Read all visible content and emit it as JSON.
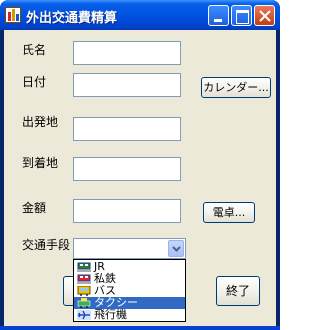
{
  "window": {
    "title": "外出交通費精算",
    "minimize_label": "minimize",
    "maximize_label": "maximize",
    "close_label": "close"
  },
  "form": {
    "name_label": "氏名",
    "date_label": "日付",
    "departure_label": "出発地",
    "arrival_label": "到着地",
    "amount_label": "金額",
    "transport_label": "交通手段",
    "name_value": "",
    "date_value": "",
    "departure_value": "",
    "arrival_value": "",
    "amount_value": "",
    "transport_value": ""
  },
  "buttons": {
    "calendar": "カレンダー...",
    "calculator": "電卓...",
    "exit": "終了"
  },
  "dropdown": {
    "options": [
      {
        "label": "JR",
        "icon": "train-icon",
        "selected": false
      },
      {
        "label": "私鉄",
        "icon": "train-icon",
        "selected": false
      },
      {
        "label": "バス",
        "icon": "bus-icon",
        "selected": false
      },
      {
        "label": "タクシー",
        "icon": "taxi-icon",
        "selected": true
      },
      {
        "label": "飛行機",
        "icon": "airplane-icon",
        "selected": false
      }
    ]
  },
  "colors": {
    "titlebar": "#0054e3",
    "window_face": "#ece9d8",
    "selection": "#316ac5",
    "input_border": "#7f9db9"
  }
}
